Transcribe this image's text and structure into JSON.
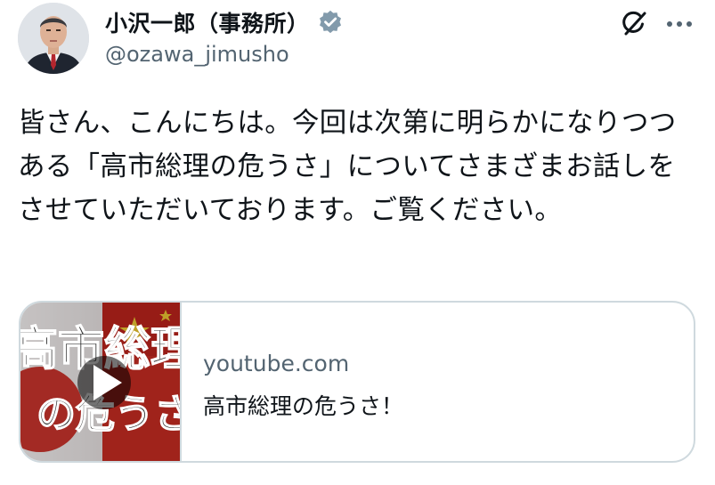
{
  "author": {
    "display_name": "小沢一郎（事務所）",
    "handle": "@ozawa_jimusho",
    "verified_color": "#829aab",
    "avatar_icon": "profile-photo"
  },
  "actions": {
    "grok_icon": "grok-icon",
    "more_icon": "more-dots-icon"
  },
  "tweet": {
    "text": "皆さん、こんにちは。今回は次第に明らかになりつつある「高市総理の危うさ」についてさまざまお話しをさせていただいております。ご覧ください。"
  },
  "link_card": {
    "domain": "youtube.com",
    "title": "高市総理の危うさ！",
    "thumbnail": {
      "line1": "高市総理",
      "line2": "の危うさ",
      "play_icon": "play-icon"
    }
  },
  "colors": {
    "text": "#0f1419",
    "secondary": "#536471",
    "border": "#cfd9de"
  }
}
